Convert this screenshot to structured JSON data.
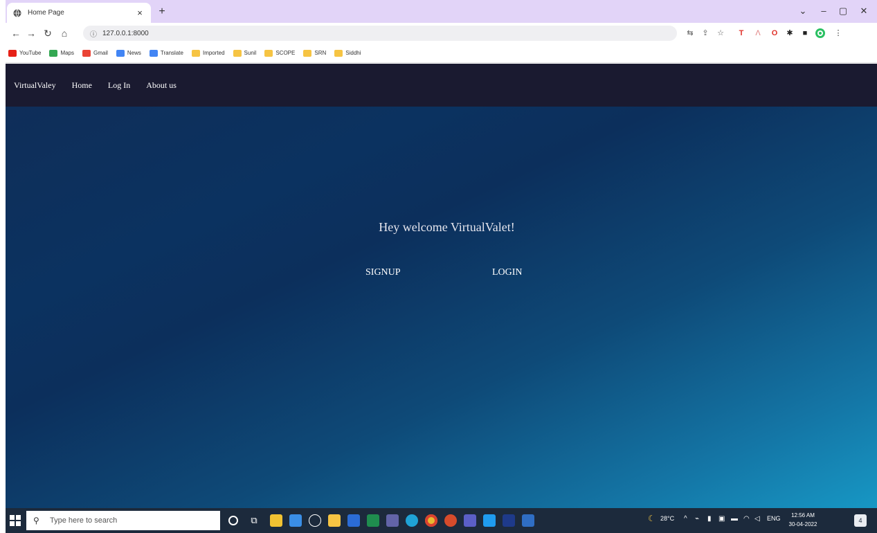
{
  "browser": {
    "tab_title": "Home Page",
    "url": "127.0.0.1:8000",
    "bookmarks": [
      "YouTube",
      "Maps",
      "Gmail",
      "News",
      "Translate",
      "Imported",
      "Sunil",
      "SCOPE",
      "SRN",
      "Siddhi"
    ]
  },
  "site": {
    "nav": {
      "brand": "VirtualValey",
      "home": "Home",
      "login": "Log In",
      "about": "About us"
    },
    "hero": {
      "welcome": "Hey welcome VirtualValet!",
      "signup": "SIGNUP",
      "login": "LOGIN"
    }
  },
  "taskbar": {
    "search_placeholder": "Type here to search",
    "weather": "28°C",
    "lang": "ENG",
    "time": "12:56 AM",
    "date": "30-04-2022",
    "notifications": "4"
  }
}
